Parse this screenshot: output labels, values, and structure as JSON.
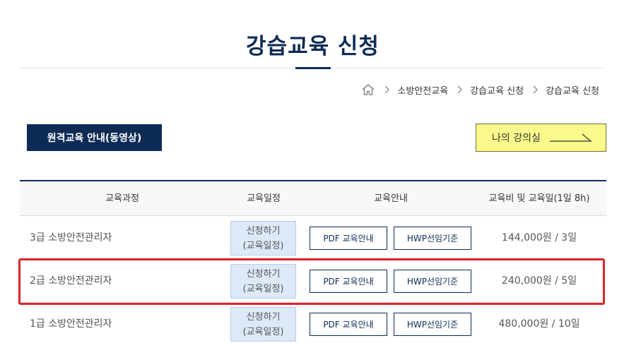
{
  "page_title": "강습교육 신청",
  "breadcrumb": {
    "items": [
      "소방안전교육",
      "강습교육 신청",
      "강습교육 신청"
    ]
  },
  "buttons": {
    "remote_guide": "원격교육 안내(동영상)",
    "my_classroom": "나의 강의실"
  },
  "table": {
    "headers": [
      "교육과정",
      "교육일정",
      "교육안내",
      "교육비 및 교육일(1일 8h)"
    ],
    "rows": [
      {
        "course": "3급 소방안전관리자",
        "apply_line1": "신청하기",
        "apply_line2": "(교육일정)",
        "pdf": "PDF 교육안내",
        "hwp": "HWP선임기준",
        "fee": "144,000원 / 3일"
      },
      {
        "course": "2급 소방안전관리자",
        "apply_line1": "신청하기",
        "apply_line2": "(교육일정)",
        "pdf": "PDF 교육안내",
        "hwp": "HWP선임기준",
        "fee": "240,000원 / 5일"
      },
      {
        "course": "1급 소방안전관리자",
        "apply_line1": "신청하기",
        "apply_line2": "(교육일정)",
        "pdf": "PDF 교육안내",
        "hwp": "HWP선임기준",
        "fee": "480,000원 / 10일"
      }
    ],
    "highlighted_row": 1
  },
  "colors": {
    "navy": "#0d2b55",
    "yellow_button": "#fafa8c",
    "apply_bg": "#dde9f7",
    "highlight_border": "#d8252c"
  },
  "icons": [
    "home-icon",
    "chevron-right-icon",
    "arrow-right-icon"
  ]
}
